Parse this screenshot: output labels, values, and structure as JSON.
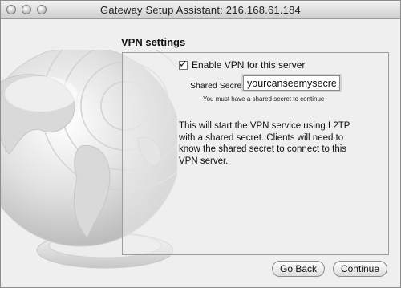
{
  "window": {
    "title": "Gateway Setup Assistant: 216.168.61.184"
  },
  "section": {
    "title": "VPN settings"
  },
  "vpn": {
    "enable_label": "Enable VPN for this server",
    "enable_checked": true,
    "secret_label": "Shared Secret:",
    "secret_value": "yourcanseemysecret",
    "hint": "You must have a shared secret to continue",
    "description": "This will start the VPN service using L2TP with a shared secret. Clients will need to know the shared secret to connect to this VPN server."
  },
  "buttons": {
    "back": "Go Back",
    "continue": "Continue"
  }
}
